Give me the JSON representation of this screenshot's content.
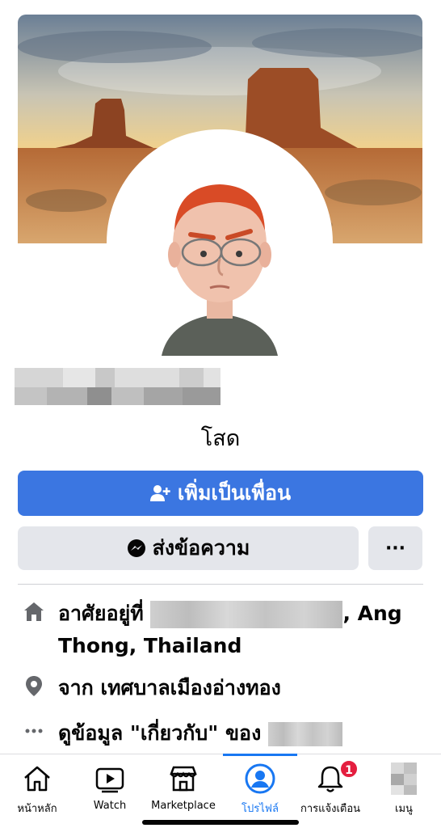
{
  "profile": {
    "relationship_status": "โสด",
    "add_friend_label": "เพิ่มเป็นเพื่อน",
    "message_label": "ส่งข้อความ",
    "more_label": "···"
  },
  "info": {
    "lives_in_prefix": "อาศัยอยู่ที่",
    "lives_in_suffix_line1": ", Ang",
    "lives_in_line2": "Thong, Thailand",
    "from_text": "จาก เทศบาลเมืองอ่างทอง",
    "about_prefix": "ดูข้อมูล \"เกี่ยวกับ\" ของ"
  },
  "tabbar": {
    "tabs": [
      {
        "label": "หน้าหลัก",
        "icon": "home-icon"
      },
      {
        "label": "Watch",
        "icon": "watch-icon"
      },
      {
        "label": "Marketplace",
        "icon": "marketplace-icon"
      },
      {
        "label": "โปรไฟล์",
        "icon": "profile-icon",
        "active": true
      },
      {
        "label": "การแจ้งเตือน",
        "icon": "bell-icon",
        "badge": "1"
      },
      {
        "label": "เมนู",
        "icon": "menu-avatar-icon"
      }
    ]
  },
  "colors": {
    "accent": "#1877f2",
    "add_button": "#3b76e1",
    "secondary_button": "#e4e6eb",
    "badge": "#e41e3f"
  }
}
